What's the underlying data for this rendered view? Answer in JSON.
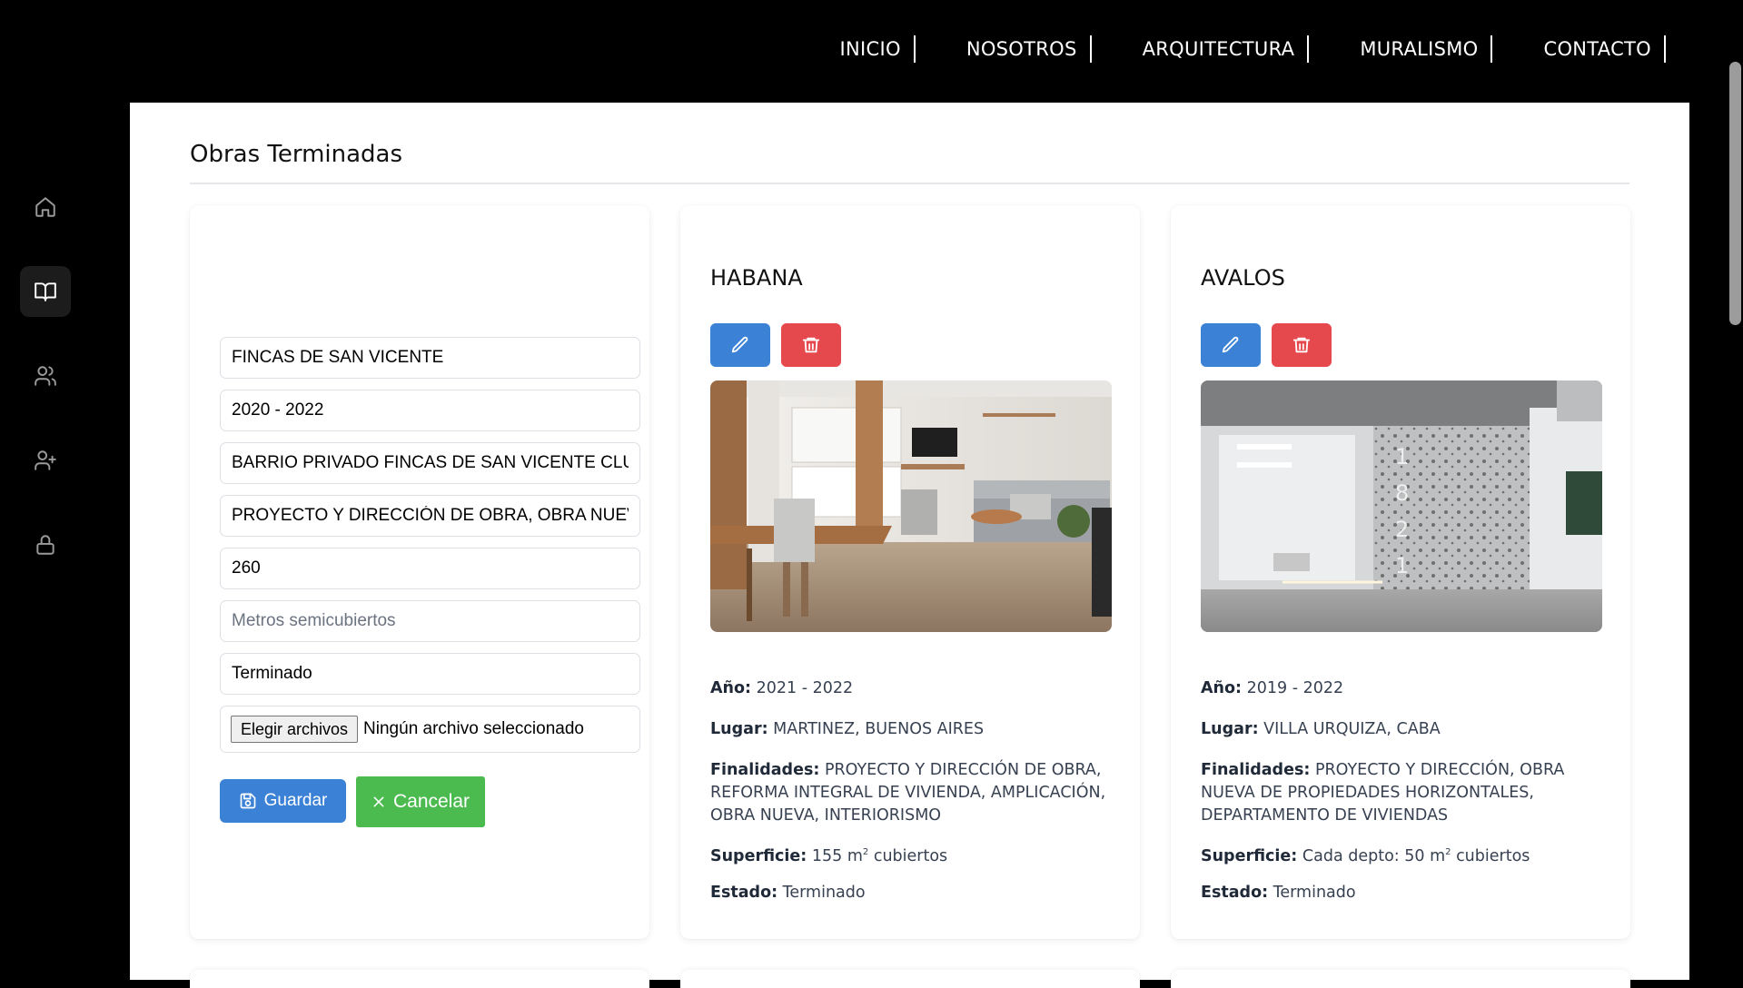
{
  "nav": {
    "items": [
      {
        "label": "INICIO"
      },
      {
        "label": "NOSOTROS"
      },
      {
        "label": "ARQUITECTURA"
      },
      {
        "label": "MURALISMO"
      },
      {
        "label": "CONTACTO"
      }
    ]
  },
  "sidebar": {
    "items": [
      {
        "icon": "home-icon"
      },
      {
        "icon": "book-open-icon",
        "active": true
      },
      {
        "icon": "users-icon"
      },
      {
        "icon": "user-plus-icon"
      },
      {
        "icon": "lock-icon"
      }
    ]
  },
  "page": {
    "title": "Obras Terminadas"
  },
  "form": {
    "name": "FINCAS DE SAN VICENTE",
    "years": "2020 - 2022",
    "location": "BARRIO PRIVADO FINCAS DE SAN VICENTE CLUB",
    "purposes": "PROYECTO Y DIRECCIÓN DE OBRA, OBRA NUEVA",
    "covered_m2": "260",
    "semicovered_placeholder": "Metros semicubiertos",
    "status": "Terminado",
    "file_button": "Elegir archivos",
    "file_status": "Ningún archivo seleccionado",
    "save_label": "Guardar",
    "cancel_label": "Cancelar"
  },
  "labels": {
    "year": "Año:",
    "place": "Lugar:",
    "purposes": "Finalidades:",
    "surface": "Superficie:",
    "status": "Estado:"
  },
  "projects": [
    {
      "title": "HABANA",
      "year": "2021 - 2022",
      "place": "MARTINEZ, BUENOS AIRES",
      "purposes": "PROYECTO Y DIRECCIÓN DE OBRA, REFORMA INTEGRAL DE VIVIENDA, AMPLICACIÓN, OBRA NUEVA, INTERIORISMO",
      "surface_pre": "155 m",
      "surface_sup": "2",
      "surface_post": " cubiertos",
      "status": "Terminado"
    },
    {
      "title": "AVALOS",
      "year": "2019 - 2022",
      "place": "VILLA URQUIZA, CABA",
      "purposes": "PROYECTO Y DIRECCIÓN, OBRA NUEVA DE PROPIEDADES HORIZONTALES, DEPARTAMENTO DE VIVIENDAS",
      "surface_pre": "Cada depto: 50 m",
      "surface_sup": "2",
      "surface_post": " cubiertos",
      "status": "Terminado",
      "facade_numbers": "1821"
    }
  ],
  "colors": {
    "edit": "#3b82d6",
    "delete": "#e5484d",
    "save": "#3b82d6",
    "cancel": "#4cbb4f"
  }
}
